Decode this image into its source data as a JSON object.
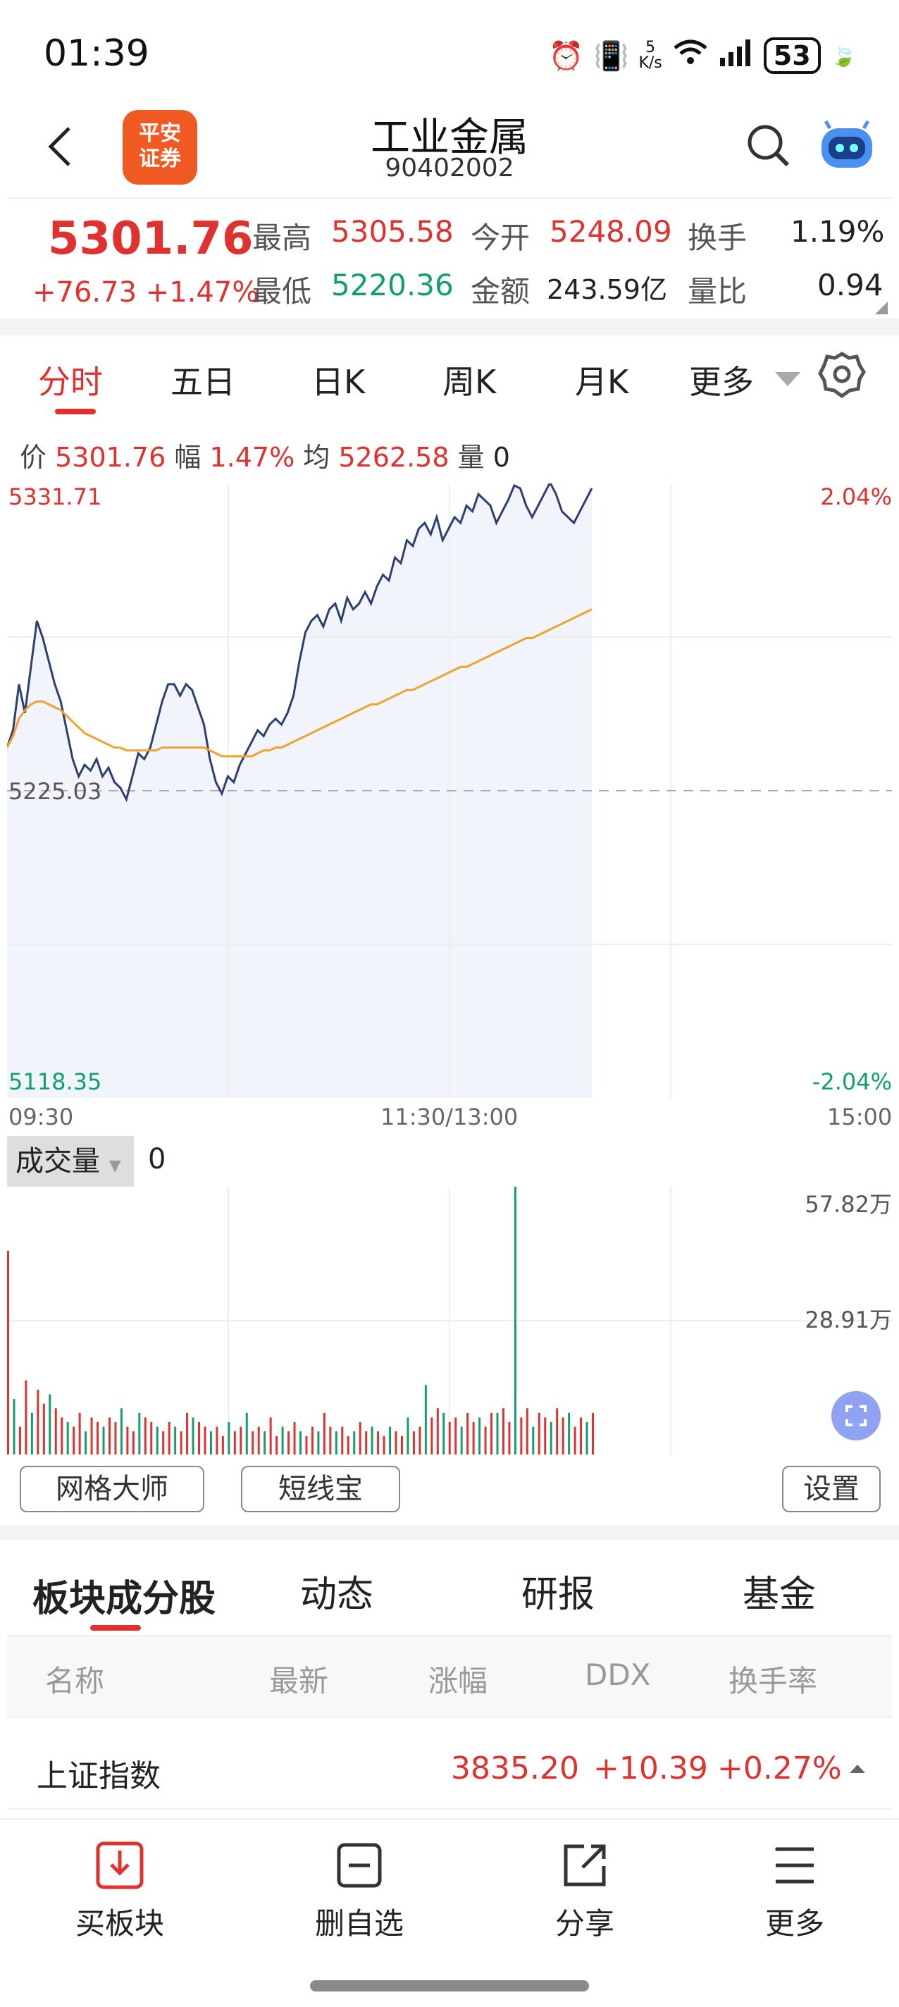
{
  "status_bar": {
    "time": "01:39",
    "speed_top": "5",
    "speed_unit": "K/s",
    "battery": "53"
  },
  "header": {
    "title": "工业金属",
    "code": "90402002",
    "logo_text_1": "平安",
    "logo_text_2": "证券"
  },
  "quote": {
    "price": "5301.76",
    "change": "+76.73 +1.47%",
    "high_label": "最高",
    "high": "5305.58",
    "open_label": "今开",
    "open": "5248.09",
    "turnover_label": "换手",
    "turnover": "1.19%",
    "low_label": "最低",
    "low": "5220.36",
    "amount_label": "金额",
    "amount": "243.59亿",
    "vol_ratio_label": "量比",
    "vol_ratio": "0.94"
  },
  "tabs": [
    "分时",
    "五日",
    "日K",
    "周K",
    "月K",
    "更多"
  ],
  "info": {
    "price_label": "价",
    "price": "5301.76",
    "range_label": "幅",
    "range": "1.47%",
    "avg_label": "均",
    "avg": "5262.58",
    "vol_label": "量",
    "vol": "0"
  },
  "chart_data": {
    "type": "line",
    "y_max_label": "5331.71",
    "y_mid_label": "5225.03",
    "y_min_label": "5118.35",
    "pct_max_label": "2.04%",
    "pct_min_label": "-2.04%",
    "x_ticks": [
      "09:30",
      "11:30/13:00",
      "15:00"
    ],
    "ylim": [
      5118.35,
      5331.71
    ],
    "reference": 5225.03,
    "series": [
      {
        "color": "#2b3f73",
        "values": [
          5240,
          5246,
          5262,
          5252,
          5268,
          5284,
          5278,
          5270,
          5262,
          5256,
          5246,
          5236,
          5230,
          5234,
          5232,
          5236,
          5230,
          5233,
          5228,
          5226,
          5222,
          5230,
          5238,
          5236,
          5240,
          5248,
          5256,
          5262,
          5262,
          5258,
          5262,
          5260,
          5254,
          5248,
          5236,
          5228,
          5224,
          5230,
          5228,
          5234,
          5238,
          5242,
          5246,
          5244,
          5248,
          5250,
          5248,
          5252,
          5258,
          5270,
          5280,
          5284,
          5286,
          5282,
          5288,
          5290,
          5284,
          5292,
          5288,
          5290,
          5294,
          5290,
          5296,
          5300,
          5298,
          5306,
          5304,
          5312,
          5310,
          5316,
          5318,
          5314,
          5320,
          5312,
          5316,
          5320,
          5318,
          5324,
          5322,
          5328,
          5326,
          5324,
          5318,
          5322,
          5326,
          5331,
          5330,
          5324,
          5320,
          5324,
          5328,
          5332,
          5328,
          5322,
          5320,
          5318,
          5322,
          5326,
          5330
        ]
      },
      {
        "color": "#f0a12e",
        "values": [
          5240,
          5244,
          5250,
          5253,
          5255,
          5256,
          5256,
          5255,
          5254,
          5253,
          5251,
          5249,
          5247,
          5245,
          5244,
          5243,
          5242,
          5241,
          5240,
          5240,
          5239,
          5239,
          5239,
          5239,
          5239,
          5239,
          5240,
          5240,
          5240,
          5240,
          5240,
          5240,
          5240,
          5240,
          5239,
          5238,
          5237,
          5237,
          5237,
          5237,
          5237,
          5237,
          5238,
          5239,
          5239,
          5240,
          5240,
          5241,
          5242,
          5243,
          5244,
          5245,
          5246,
          5247,
          5248,
          5249,
          5250,
          5251,
          5252,
          5253,
          5254,
          5255,
          5255,
          5256,
          5257,
          5258,
          5259,
          5260,
          5260,
          5261,
          5262,
          5263,
          5264,
          5265,
          5266,
          5267,
          5268,
          5268,
          5269,
          5270,
          5271,
          5272,
          5273,
          5274,
          5275,
          5276,
          5277,
          5278,
          5278,
          5279,
          5280,
          5281,
          5282,
          5283,
          5284,
          5285,
          5286,
          5287,
          5288
        ]
      }
    ]
  },
  "volume": {
    "label": "成交量",
    "value": "0",
    "max_label": "57.82万",
    "mid_label": "28.91万",
    "ymax": 57.82,
    "bars": [
      44,
      12,
      6,
      16,
      9,
      14,
      11,
      13,
      10,
      8,
      7,
      6,
      9,
      5,
      8,
      7,
      6,
      8,
      7,
      10,
      6,
      5,
      9,
      8,
      7,
      6,
      5,
      7,
      6,
      5,
      9,
      8,
      7,
      6,
      5,
      6,
      4,
      7,
      5,
      6,
      9,
      5,
      6,
      5,
      8,
      4,
      6,
      5,
      7,
      5,
      4,
      6,
      5,
      9,
      6,
      5,
      6,
      4,
      5,
      7,
      5,
      6,
      5,
      4,
      6,
      5,
      4,
      8,
      5,
      6,
      15,
      8,
      10,
      9,
      7,
      8,
      6,
      9,
      7,
      8,
      6,
      9,
      9,
      10,
      7,
      60,
      8,
      10,
      6,
      9,
      8,
      7,
      10,
      8,
      9,
      6,
      8,
      7,
      9
    ]
  },
  "buttons": {
    "grid": "网格大师",
    "short": "短线宝",
    "settings": "设置"
  },
  "sub_tabs": [
    "板块成分股",
    "动态",
    "研报",
    "基金"
  ],
  "columns": [
    "名称",
    "最新",
    "涨幅",
    "DDX",
    "换手率"
  ],
  "row": {
    "name": "上证指数",
    "last": "3835.20",
    "change": "+10.39",
    "pct": "+0.27%"
  },
  "bottom_nav": [
    "买板块",
    "删自选",
    "分享",
    "更多"
  ],
  "colors": {
    "up": "#e0312f",
    "down": "#11a06b",
    "price_line": "#2b3f73",
    "avg_line": "#f0a12e"
  }
}
